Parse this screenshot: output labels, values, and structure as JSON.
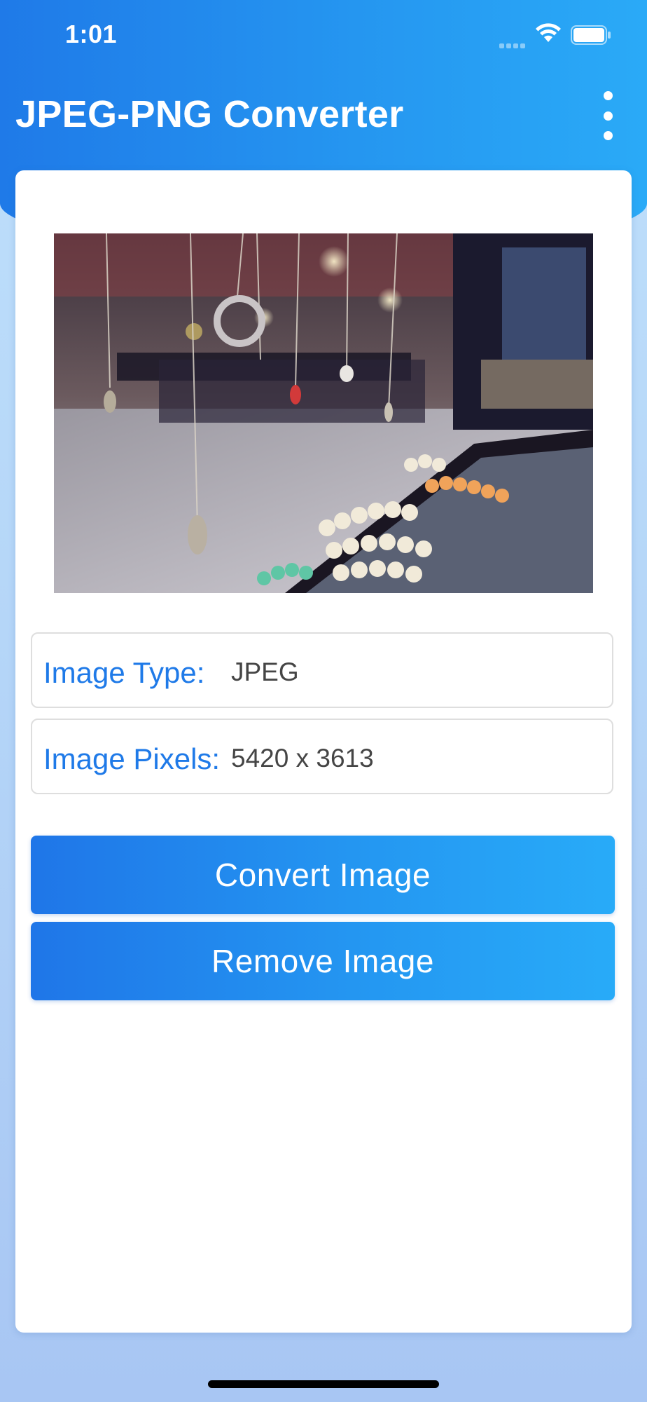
{
  "status_bar": {
    "time": "1:01",
    "icons": [
      "signal-icon",
      "wifi-icon",
      "battery-icon"
    ]
  },
  "app_bar": {
    "title": "JPEG-PNG Converter",
    "menu_icon": "more-vertical-icon"
  },
  "image_info": {
    "type_label": "Image Type:",
    "type_value": "JPEG",
    "pixels_label": "Image Pixels:",
    "pixels_value": "5420 x 3613"
  },
  "actions": {
    "convert_label": "Convert Image",
    "remove_label": "Remove Image"
  },
  "colors": {
    "accent": "#1f7ae8",
    "accent_light": "#2aaaf7",
    "background_light": "#bfe0fb"
  }
}
